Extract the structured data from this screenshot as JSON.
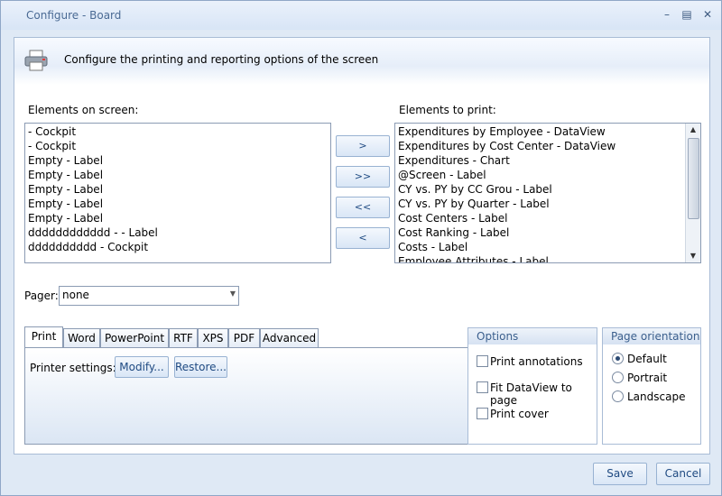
{
  "window": {
    "title": "Configure - Board"
  },
  "header": {
    "text": "Configure the printing and reporting options of the screen",
    "icon": "printer-icon"
  },
  "screen_list": {
    "label": "Elements on screen:",
    "items": [
      " - Cockpit",
      " - Cockpit",
      "Empty - Label",
      "Empty - Label",
      "Empty - Label",
      "Empty - Label",
      "Empty - Label",
      "dddddddddddd -  - Label",
      "dddddddddd - Cockpit"
    ]
  },
  "print_list": {
    "label": "Elements to print:",
    "items": [
      "Expenditures by Employee - DataView",
      "Expenditures by Cost Center - DataView",
      "Expenditures - Chart",
      "@Screen - Label",
      "CY vs. PY by CC Grou - Label",
      "CY vs. PY by Quarter - Label",
      "Cost Centers - Label",
      "Cost Ranking - Label",
      "Costs - Label",
      "Employee Attributes - Label"
    ]
  },
  "move_buttons": {
    "add": ">",
    "add_all": ">>",
    "remove_all": "<<",
    "remove": "<"
  },
  "pager": {
    "label": "Pager:",
    "value": "none"
  },
  "tabs": [
    "Print",
    "Word",
    "PowerPoint",
    "RTF",
    "XPS",
    "PDF",
    "Advanced"
  ],
  "print_tab": {
    "printer_label": "Printer settings:",
    "modify": "Modify...",
    "restore": "Restore..."
  },
  "options": {
    "title": "Options",
    "annotations": "Print annotations",
    "fit": "Fit DataView to page",
    "cover": "Print cover"
  },
  "orientation": {
    "title": "Page orientation",
    "default": "Default",
    "portrait": "Portrait",
    "landscape": "Landscape",
    "selected": "Default"
  },
  "footer": {
    "save": "Save",
    "cancel": "Cancel"
  }
}
